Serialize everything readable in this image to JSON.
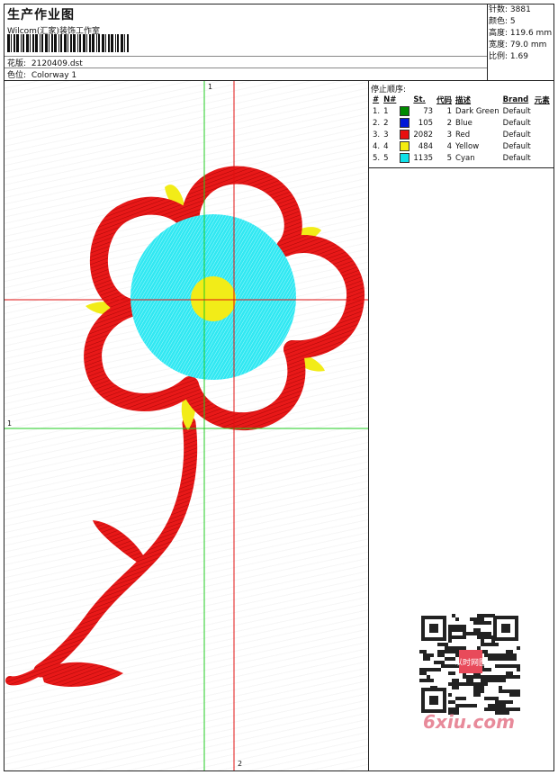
{
  "header": {
    "title": "生产作业图",
    "company": "Wilcom(汇家)装饰工作室",
    "design_label": "花版:",
    "design_value": "2120409.dst",
    "colorway_label": "色位:",
    "colorway_value": "Colorway 1"
  },
  "stats": [
    {
      "label": "针数:",
      "value": "3881"
    },
    {
      "label": "颜色:",
      "value": "5"
    },
    {
      "label": "高度:",
      "value": "119.6 mm"
    },
    {
      "label": "宽度:",
      "value": "79.0 mm"
    },
    {
      "label": "比例:",
      "value": "1.69"
    }
  ],
  "stop_sequence": {
    "title": "停止顺序:",
    "columns": [
      "#",
      "N#",
      "St.",
      "代码",
      "描述",
      "Brand",
      "元素"
    ],
    "rows": [
      {
        "idx": "1.",
        "n": "1",
        "color": "#008a00",
        "stitches": "73",
        "code": "1",
        "desc": "Dark Green",
        "brand": "Default"
      },
      {
        "idx": "2.",
        "n": "2",
        "color": "#0018d8",
        "stitches": "105",
        "code": "2",
        "desc": "Blue",
        "brand": "Default"
      },
      {
        "idx": "3.",
        "n": "3",
        "color": "#e81010",
        "stitches": "2082",
        "code": "3",
        "desc": "Red",
        "brand": "Default"
      },
      {
        "idx": "4.",
        "n": "4",
        "color": "#f4ec10",
        "stitches": "484",
        "code": "4",
        "desc": "Yellow",
        "brand": "Default"
      },
      {
        "idx": "5.",
        "n": "5",
        "color": "#10e0e8",
        "stitches": "1135",
        "code": "5",
        "desc": "Cyan",
        "brand": "Default"
      }
    ]
  },
  "axes": {
    "label_1_top": "1",
    "label_1_left": "1",
    "label_2_bottom": "2"
  },
  "colors": {
    "red": "#e81818",
    "cyan": "#18e6f0",
    "yellow": "#f2ec18",
    "green_line": "#22cc22",
    "red_line": "#e01010"
  },
  "watermark": {
    "text": "6xiu.com",
    "stamp": "以时网图"
  }
}
